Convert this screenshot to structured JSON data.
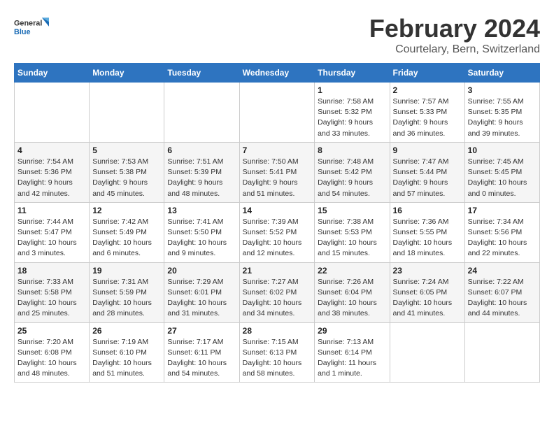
{
  "header": {
    "logo_general": "General",
    "logo_blue": "Blue",
    "title": "February 2024",
    "subtitle": "Courtelary, Bern, Switzerland"
  },
  "weekdays": [
    "Sunday",
    "Monday",
    "Tuesday",
    "Wednesday",
    "Thursday",
    "Friday",
    "Saturday"
  ],
  "weeks": [
    [
      {
        "day": "",
        "sunrise": "",
        "sunset": "",
        "daylight": ""
      },
      {
        "day": "",
        "sunrise": "",
        "sunset": "",
        "daylight": ""
      },
      {
        "day": "",
        "sunrise": "",
        "sunset": "",
        "daylight": ""
      },
      {
        "day": "",
        "sunrise": "",
        "sunset": "",
        "daylight": ""
      },
      {
        "day": "1",
        "sunrise": "7:58 AM",
        "sunset": "5:32 PM",
        "daylight": "9 hours and 33 minutes."
      },
      {
        "day": "2",
        "sunrise": "7:57 AM",
        "sunset": "5:33 PM",
        "daylight": "9 hours and 36 minutes."
      },
      {
        "day": "3",
        "sunrise": "7:55 AM",
        "sunset": "5:35 PM",
        "daylight": "9 hours and 39 minutes."
      }
    ],
    [
      {
        "day": "4",
        "sunrise": "7:54 AM",
        "sunset": "5:36 PM",
        "daylight": "9 hours and 42 minutes."
      },
      {
        "day": "5",
        "sunrise": "7:53 AM",
        "sunset": "5:38 PM",
        "daylight": "9 hours and 45 minutes."
      },
      {
        "day": "6",
        "sunrise": "7:51 AM",
        "sunset": "5:39 PM",
        "daylight": "9 hours and 48 minutes."
      },
      {
        "day": "7",
        "sunrise": "7:50 AM",
        "sunset": "5:41 PM",
        "daylight": "9 hours and 51 minutes."
      },
      {
        "day": "8",
        "sunrise": "7:48 AM",
        "sunset": "5:42 PM",
        "daylight": "9 hours and 54 minutes."
      },
      {
        "day": "9",
        "sunrise": "7:47 AM",
        "sunset": "5:44 PM",
        "daylight": "9 hours and 57 minutes."
      },
      {
        "day": "10",
        "sunrise": "7:45 AM",
        "sunset": "5:45 PM",
        "daylight": "10 hours and 0 minutes."
      }
    ],
    [
      {
        "day": "11",
        "sunrise": "7:44 AM",
        "sunset": "5:47 PM",
        "daylight": "10 hours and 3 minutes."
      },
      {
        "day": "12",
        "sunrise": "7:42 AM",
        "sunset": "5:49 PM",
        "daylight": "10 hours and 6 minutes."
      },
      {
        "day": "13",
        "sunrise": "7:41 AM",
        "sunset": "5:50 PM",
        "daylight": "10 hours and 9 minutes."
      },
      {
        "day": "14",
        "sunrise": "7:39 AM",
        "sunset": "5:52 PM",
        "daylight": "10 hours and 12 minutes."
      },
      {
        "day": "15",
        "sunrise": "7:38 AM",
        "sunset": "5:53 PM",
        "daylight": "10 hours and 15 minutes."
      },
      {
        "day": "16",
        "sunrise": "7:36 AM",
        "sunset": "5:55 PM",
        "daylight": "10 hours and 18 minutes."
      },
      {
        "day": "17",
        "sunrise": "7:34 AM",
        "sunset": "5:56 PM",
        "daylight": "10 hours and 22 minutes."
      }
    ],
    [
      {
        "day": "18",
        "sunrise": "7:33 AM",
        "sunset": "5:58 PM",
        "daylight": "10 hours and 25 minutes."
      },
      {
        "day": "19",
        "sunrise": "7:31 AM",
        "sunset": "5:59 PM",
        "daylight": "10 hours and 28 minutes."
      },
      {
        "day": "20",
        "sunrise": "7:29 AM",
        "sunset": "6:01 PM",
        "daylight": "10 hours and 31 minutes."
      },
      {
        "day": "21",
        "sunrise": "7:27 AM",
        "sunset": "6:02 PM",
        "daylight": "10 hours and 34 minutes."
      },
      {
        "day": "22",
        "sunrise": "7:26 AM",
        "sunset": "6:04 PM",
        "daylight": "10 hours and 38 minutes."
      },
      {
        "day": "23",
        "sunrise": "7:24 AM",
        "sunset": "6:05 PM",
        "daylight": "10 hours and 41 minutes."
      },
      {
        "day": "24",
        "sunrise": "7:22 AM",
        "sunset": "6:07 PM",
        "daylight": "10 hours and 44 minutes."
      }
    ],
    [
      {
        "day": "25",
        "sunrise": "7:20 AM",
        "sunset": "6:08 PM",
        "daylight": "10 hours and 48 minutes."
      },
      {
        "day": "26",
        "sunrise": "7:19 AM",
        "sunset": "6:10 PM",
        "daylight": "10 hours and 51 minutes."
      },
      {
        "day": "27",
        "sunrise": "7:17 AM",
        "sunset": "6:11 PM",
        "daylight": "10 hours and 54 minutes."
      },
      {
        "day": "28",
        "sunrise": "7:15 AM",
        "sunset": "6:13 PM",
        "daylight": "10 hours and 58 minutes."
      },
      {
        "day": "29",
        "sunrise": "7:13 AM",
        "sunset": "6:14 PM",
        "daylight": "11 hours and 1 minute."
      },
      {
        "day": "",
        "sunrise": "",
        "sunset": "",
        "daylight": ""
      },
      {
        "day": "",
        "sunrise": "",
        "sunset": "",
        "daylight": ""
      }
    ]
  ],
  "labels": {
    "sunrise": "Sunrise:",
    "sunset": "Sunset:",
    "daylight": "Daylight:"
  }
}
